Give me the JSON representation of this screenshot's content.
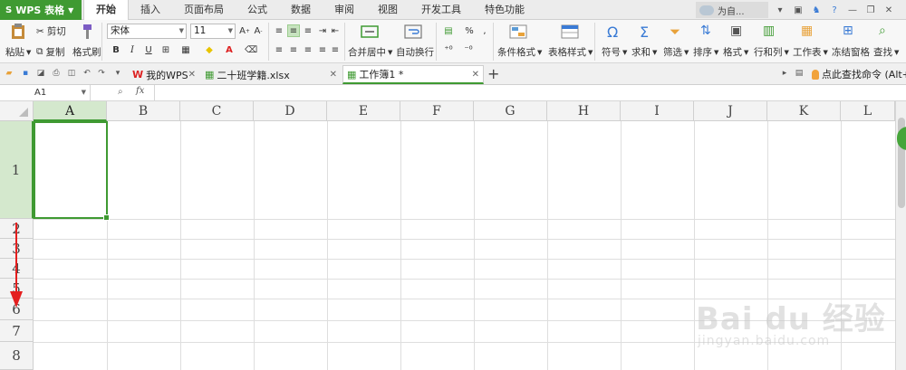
{
  "menubar": {
    "app_label": "WPS 表格",
    "tabs": [
      "开始",
      "插入",
      "页面布局",
      "公式",
      "数据",
      "审阅",
      "视图",
      "开发工具",
      "特色功能"
    ],
    "active_tab": "开始",
    "user_label": "为自..."
  },
  "ribbon": {
    "paste": "粘贴",
    "cut": "剪切",
    "copy": "复制",
    "format_painter": "格式刷",
    "font_name": "宋体",
    "font_size": "11",
    "bold": "B",
    "italic": "I",
    "underline": "U",
    "merge_center": "合并居中",
    "wrap_text": "自动换行",
    "conditional_format": "条件格式",
    "table_style": "表格样式",
    "symbol": "符号",
    "sum": "求和",
    "filter": "筛选",
    "sort": "排序",
    "format": "格式",
    "row_col": "行和列",
    "worksheet": "工作表",
    "freeze": "冻结窗格",
    "find": "查找"
  },
  "doctabs": [
    {
      "label": "我的WPS",
      "active": false
    },
    {
      "label": "二十班学籍.xlsx",
      "active": false
    },
    {
      "label": "工作簿1 *",
      "active": true
    }
  ],
  "find_command": "点此查找命令 (Alt+Q",
  "formula_bar": {
    "cell_ref": "A1",
    "fx": "fx",
    "value": ""
  },
  "grid": {
    "columns": [
      "A",
      "B",
      "C",
      "D",
      "E",
      "F",
      "G",
      "H",
      "I",
      "J",
      "K",
      "L"
    ],
    "rows": [
      "1",
      "2",
      "3",
      "4",
      "5",
      "6",
      "7",
      "8"
    ],
    "selected_column": "A",
    "selected_row": "1"
  },
  "watermark": {
    "brand": "Bai du 经验",
    "url": "jingyan.baidu.com"
  },
  "colors": {
    "accent": "#3f9a32",
    "annotation": "#e41e1e"
  }
}
